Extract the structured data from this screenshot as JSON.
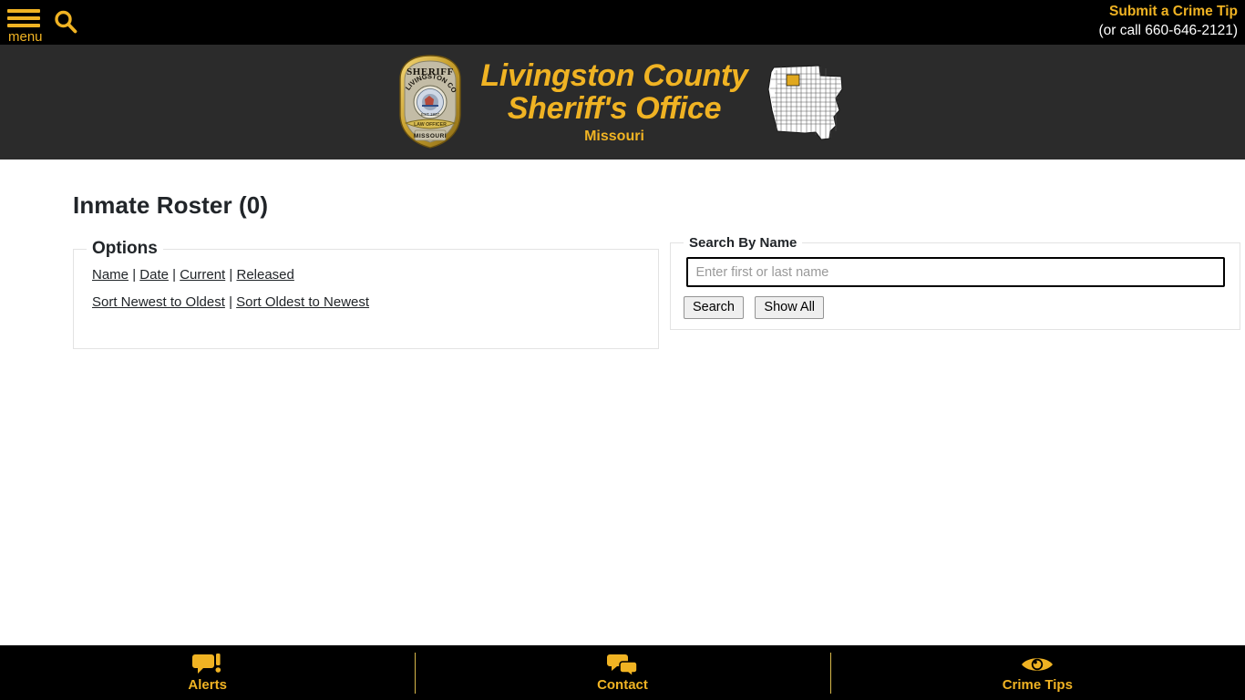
{
  "topbar": {
    "menu_label": "menu",
    "menu_icon": "hamburger-icon",
    "search_icon": "search-icon",
    "crime_tip_label": "Submit a Crime Tip",
    "crime_tip_phone": "(or call 660-646-2121)"
  },
  "banner": {
    "badge_icon": "sheriff-badge-icon",
    "badge_text_top": "SHERIFF",
    "badge_text_arc": "LIVINGSTON CO.",
    "badge_text_bottom": "MISSOURI",
    "title_line1": "Livingston County",
    "title_line2": "Sheriff's Office",
    "subtitle": "Missouri",
    "map_icon": "missouri-state-map-icon"
  },
  "main": {
    "page_title": "Inmate Roster (0)",
    "options": {
      "legend": "Options",
      "filter_links": [
        "Name",
        "Date",
        "Current",
        "Released"
      ],
      "sort_links": [
        "Sort Newest to Oldest",
        "Sort Oldest to Newest"
      ],
      "separator": "|"
    },
    "search": {
      "legend": "Search By Name",
      "input_value": "",
      "input_placeholder": "Enter first or last name",
      "search_button": "Search",
      "show_all_button": "Show All"
    }
  },
  "footer": {
    "items": [
      {
        "label": "Alerts",
        "icon": "speech-bubble-alert-icon"
      },
      {
        "label": "Contact",
        "icon": "two-speech-bubbles-icon"
      },
      {
        "label": "Crime Tips",
        "icon": "eye-icon"
      }
    ]
  },
  "colors": {
    "gold": "#f0b323",
    "black": "#000000",
    "banner_gray": "#2b2b2b",
    "text_dark": "#212529"
  }
}
